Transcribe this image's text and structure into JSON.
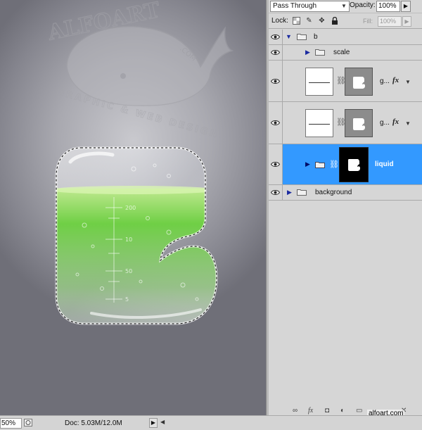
{
  "canvas": {
    "watermark_main": "ALFOART",
    "watermark_com": ".COM",
    "watermark_tagline": "GRAPHIC & WEB DESIGN",
    "scale_labels": [
      "200",
      "10",
      "50",
      "5"
    ]
  },
  "layers_panel": {
    "blend_mode": "Pass Through",
    "opacity_label": "Opacity:",
    "opacity_value": "100%",
    "lock_label": "Lock:",
    "fill_label": "Fill:",
    "fill_value": "100%",
    "layers": [
      {
        "name": "b",
        "type": "group",
        "expanded": true
      },
      {
        "name": "scale",
        "type": "group",
        "expanded": false
      },
      {
        "name": "g...",
        "type": "layer",
        "fx": "fx"
      },
      {
        "name": "g...",
        "type": "layer",
        "fx": "fx"
      },
      {
        "name": "liquid",
        "type": "group",
        "selected": true
      },
      {
        "name": "background",
        "type": "group",
        "expanded": false
      }
    ],
    "watermark_site": "alfoart.com"
  },
  "status_bar": {
    "zoom": "50%",
    "doc_info": "Doc: 5.03M/12.0M"
  },
  "colors": {
    "selection": "#3399ff",
    "panel_bg": "#d6d6d6",
    "liquid_green": "#5fc43a"
  }
}
